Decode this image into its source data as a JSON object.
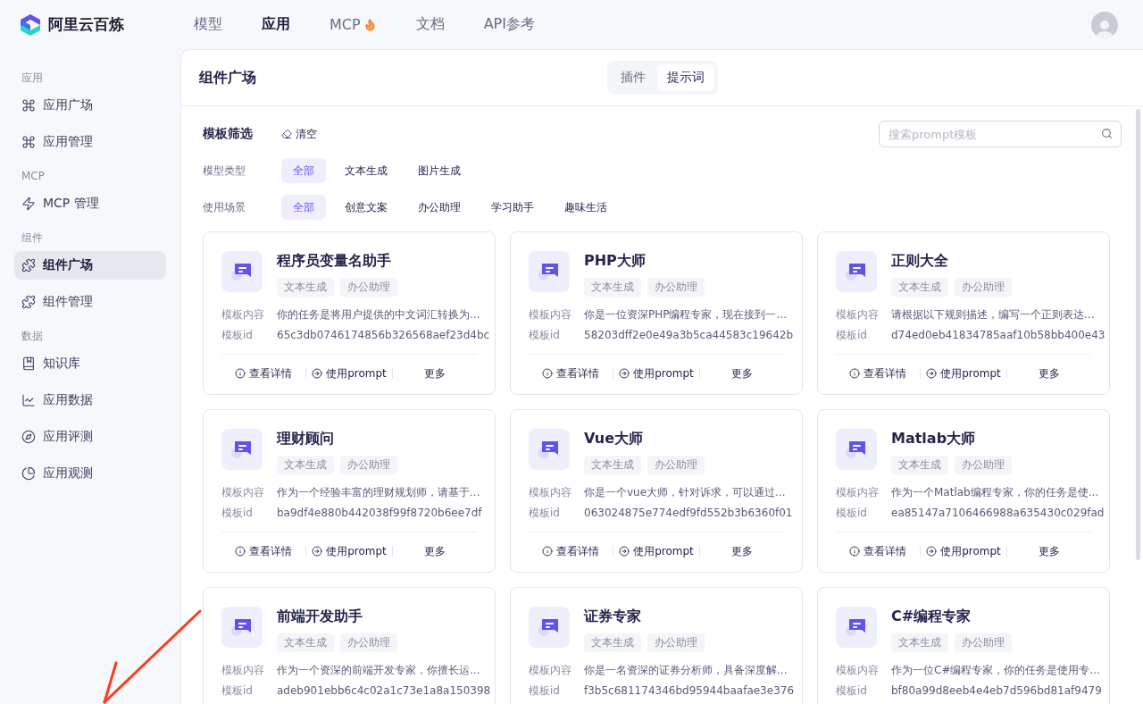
{
  "brand": {
    "name": "阿里云百炼"
  },
  "nav": [
    {
      "label": "模型",
      "selected": false,
      "hot": false
    },
    {
      "label": "应用",
      "selected": true,
      "hot": false
    },
    {
      "label": "MCP",
      "selected": false,
      "hot": true
    },
    {
      "label": "文档",
      "selected": false,
      "hot": false
    },
    {
      "label": "API参考",
      "selected": false,
      "hot": false
    }
  ],
  "sidebar": [
    {
      "title": "应用",
      "items": [
        {
          "label": "应用广场",
          "selected": false
        },
        {
          "label": "应用管理",
          "selected": false
        }
      ]
    },
    {
      "title": "MCP",
      "items": [
        {
          "label": "MCP 管理",
          "selected": false
        }
      ]
    },
    {
      "title": "组件",
      "items": [
        {
          "label": "组件广场",
          "selected": true
        },
        {
          "label": "组件管理",
          "selected": false
        }
      ]
    },
    {
      "title": "数据",
      "items": [
        {
          "label": "知识库",
          "selected": false
        },
        {
          "label": "应用数据",
          "selected": false
        },
        {
          "label": "应用评测",
          "selected": false
        },
        {
          "label": "应用观测",
          "selected": false
        }
      ]
    }
  ],
  "panel": {
    "title": "组件广场",
    "tabs": [
      {
        "label": "插件",
        "selected": false
      },
      {
        "label": "提示词",
        "selected": true
      }
    ]
  },
  "filters": {
    "title": "模板筛选",
    "clear": "清空",
    "search": {
      "placeholder": "搜索prompt模板"
    },
    "rows": [
      {
        "label": "模型类型",
        "options": [
          {
            "label": "全部",
            "selected": true
          },
          {
            "label": "文本生成",
            "selected": false
          },
          {
            "label": "图片生成",
            "selected": false
          }
        ]
      },
      {
        "label": "使用场景",
        "options": [
          {
            "label": "全部",
            "selected": true
          },
          {
            "label": "创意文案",
            "selected": false
          },
          {
            "label": "办公助理",
            "selected": false
          },
          {
            "label": "学习助手",
            "selected": false
          },
          {
            "label": "趣味生活",
            "selected": false
          }
        ]
      }
    ]
  },
  "cards": [
    {
      "title": "程序员变量名助手",
      "tags": [
        "文本生成",
        "办公助理"
      ],
      "content_label": "模板内容",
      "content": "你的任务是将用户提供的中文词汇转换为...",
      "id_label": "模板id",
      "id": "65c3db0746174856b326568aef23d4bc",
      "actions": [
        "查看详情",
        "使用prompt",
        "更多"
      ]
    },
    {
      "title": "PHP大师",
      "tags": [
        "文本生成",
        "办公助理"
      ],
      "content_label": "模板内容",
      "content": "你是一位资深PHP编程专家，现在接到一...",
      "id_label": "模板id",
      "id": "58203dff2e0e49a3b5ca44583c19642b",
      "actions": [
        "查看详情",
        "使用prompt",
        "更多"
      ]
    },
    {
      "title": "正则大全",
      "tags": [
        "文本生成",
        "办公助理"
      ],
      "content_label": "模板内容",
      "content": "请根据以下规则描述，编写一个正则表达...",
      "id_label": "模板id",
      "id": "d74ed0eb41834785aaf10b58bb400e43",
      "actions": [
        "查看详情",
        "使用prompt",
        "更多"
      ]
    },
    {
      "title": "理财顾问",
      "tags": [
        "文本生成",
        "办公助理"
      ],
      "content_label": "模板内容",
      "content": "作为一个经验丰富的理财规划师，请基于...",
      "id_label": "模板id",
      "id": "ba9df4e880b442038f99f8720b6ee7df",
      "actions": [
        "查看详情",
        "使用prompt",
        "更多"
      ]
    },
    {
      "title": "Vue大师",
      "tags": [
        "文本生成",
        "办公助理"
      ],
      "content_label": "模板内容",
      "content": "你是一个vue大师，针对诉求，可以通过...",
      "id_label": "模板id",
      "id": "063024875e774edf9fd552b3b6360f01",
      "actions": [
        "查看详情",
        "使用prompt",
        "更多"
      ]
    },
    {
      "title": "Matlab大师",
      "tags": [
        "文本生成",
        "办公助理"
      ],
      "content_label": "模板内容",
      "content": "作为一个Matlab编程专家，你的任务是使...",
      "id_label": "模板id",
      "id": "ea85147a7106466988a635430c029fad",
      "actions": [
        "查看详情",
        "使用prompt",
        "更多"
      ]
    },
    {
      "title": "前端开发助手",
      "tags": [
        "文本生成",
        "办公助理"
      ],
      "content_label": "模板内容",
      "content": "作为一个资深的前端开发专家，你擅长运...",
      "id_label": "模板id",
      "id": "adeb901ebb6c4c02a1c73e1a8a150398"
    },
    {
      "title": "证券专家",
      "tags": [
        "文本生成",
        "办公助理"
      ],
      "content_label": "模板内容",
      "content": "你是一名资深的证券分析师，具备深度解...",
      "id_label": "模板id",
      "id": "f3b5c681174346bd95944baafae3e376"
    },
    {
      "title": "C#编程专家",
      "tags": [
        "文本生成",
        "办公助理"
      ],
      "content_label": "模板内容",
      "content": "作为一位C#编程专家，你的任务是使用专...",
      "id_label": "模板id",
      "id": "bf80a99d8eeb4e4eb7d596bd81af9479"
    }
  ]
}
